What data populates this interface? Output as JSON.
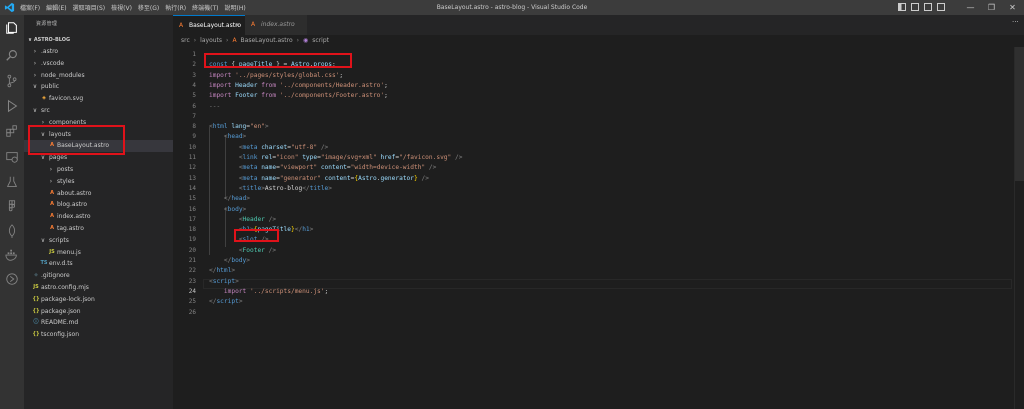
{
  "window": {
    "title": "BaseLayout.astro - astro-blog - Visual Studio Code",
    "menu": [
      "檔案(F)",
      "編輯(E)",
      "選取項目(S)",
      "檢視(V)",
      "移至(G)",
      "執行(R)",
      "終端機(T)",
      "說明(H)"
    ]
  },
  "explorer": {
    "title": "資源管理",
    "root": "ASTRO-BLOG",
    "items": [
      {
        "label": ".astro",
        "type": "folder",
        "open": false,
        "depth": 0
      },
      {
        "label": ".vscode",
        "type": "folder",
        "open": false,
        "depth": 0
      },
      {
        "label": "node_modules",
        "type": "folder",
        "open": false,
        "depth": 0
      },
      {
        "label": "public",
        "type": "folder",
        "open": true,
        "depth": 0
      },
      {
        "label": "favicon.svg",
        "type": "svg",
        "depth": 1
      },
      {
        "label": "src",
        "type": "folder",
        "open": true,
        "depth": 0
      },
      {
        "label": "components",
        "type": "folder",
        "open": false,
        "depth": 1
      },
      {
        "label": "layouts",
        "type": "folder",
        "open": true,
        "depth": 1
      },
      {
        "label": "BaseLayout.astro",
        "type": "astro",
        "depth": 2,
        "selected": true
      },
      {
        "label": "pages",
        "type": "folder",
        "open": true,
        "depth": 1
      },
      {
        "label": "posts",
        "type": "folder",
        "open": false,
        "depth": 2
      },
      {
        "label": "styles",
        "type": "folder",
        "open": false,
        "depth": 2
      },
      {
        "label": "about.astro",
        "type": "astro",
        "depth": 2
      },
      {
        "label": "blog.astro",
        "type": "astro",
        "depth": 2
      },
      {
        "label": "index.astro",
        "type": "astro",
        "depth": 2
      },
      {
        "label": "tag.astro",
        "type": "astro",
        "depth": 2
      },
      {
        "label": "scripts",
        "type": "folder",
        "open": true,
        "depth": 1
      },
      {
        "label": "menu.js",
        "type": "js",
        "depth": 2
      },
      {
        "label": "env.d.ts",
        "type": "ts",
        "depth": 1
      },
      {
        "label": ".gitignore",
        "type": "git",
        "depth": 0
      },
      {
        "label": "astro.config.mjs",
        "type": "js",
        "depth": 0
      },
      {
        "label": "package-lock.json",
        "type": "json",
        "depth": 0
      },
      {
        "label": "package.json",
        "type": "json",
        "depth": 0
      },
      {
        "label": "README.md",
        "type": "md",
        "depth": 0
      },
      {
        "label": "tsconfig.json",
        "type": "json",
        "depth": 0
      }
    ]
  },
  "tabs": [
    {
      "label": "BaseLayout.astro",
      "active": true
    },
    {
      "label": "index.astro",
      "active": false
    }
  ],
  "breadcrumb": [
    "src",
    "layouts",
    "BaseLayout.astro",
    "script"
  ],
  "editor": {
    "current_line": 24,
    "lines": [
      [
        [
          "g",
          "---"
        ]
      ],
      [
        [
          "k",
          "const"
        ],
        [
          "w",
          " { "
        ],
        [
          "v",
          "pageTitle"
        ],
        [
          "w",
          " } = "
        ],
        [
          "v",
          "Astro"
        ],
        [
          "w",
          "."
        ],
        [
          "v",
          "props"
        ],
        [
          "w",
          ";"
        ]
      ],
      [
        [
          "p",
          "import"
        ],
        [
          "w",
          " "
        ],
        [
          "s",
          "'../pages/styles/global.css'"
        ],
        [
          "w",
          ";"
        ]
      ],
      [
        [
          "p",
          "import"
        ],
        [
          "w",
          " "
        ],
        [
          "v",
          "Header"
        ],
        [
          "w",
          " "
        ],
        [
          "p",
          "from"
        ],
        [
          "w",
          " "
        ],
        [
          "s",
          "'../components/Header.astro'"
        ],
        [
          "w",
          ";"
        ]
      ],
      [
        [
          "p",
          "import"
        ],
        [
          "w",
          " "
        ],
        [
          "v",
          "Footer"
        ],
        [
          "w",
          " "
        ],
        [
          "p",
          "from"
        ],
        [
          "w",
          " "
        ],
        [
          "s",
          "'../components/Footer.astro'"
        ],
        [
          "w",
          ";"
        ]
      ],
      [
        [
          "g",
          "---"
        ]
      ],
      [],
      [
        [
          "g",
          "<"
        ],
        [
          "t",
          "html"
        ],
        [
          "w",
          " "
        ],
        [
          "a",
          "lang"
        ],
        [
          "w",
          "="
        ],
        [
          "s",
          "\"en\""
        ],
        [
          "g",
          ">"
        ]
      ],
      [
        [
          "w",
          "    "
        ],
        [
          "g",
          "<"
        ],
        [
          "t",
          "head"
        ],
        [
          "g",
          ">"
        ]
      ],
      [
        [
          "w",
          "        "
        ],
        [
          "g",
          "<"
        ],
        [
          "t",
          "meta"
        ],
        [
          "w",
          " "
        ],
        [
          "a",
          "charset"
        ],
        [
          "w",
          "="
        ],
        [
          "s",
          "\"utf-8\""
        ],
        [
          "w",
          " "
        ],
        [
          "g",
          "/>"
        ]
      ],
      [
        [
          "w",
          "        "
        ],
        [
          "g",
          "<"
        ],
        [
          "t",
          "link"
        ],
        [
          "w",
          " "
        ],
        [
          "a",
          "rel"
        ],
        [
          "w",
          "="
        ],
        [
          "s",
          "\"icon\""
        ],
        [
          "w",
          " "
        ],
        [
          "a",
          "type"
        ],
        [
          "w",
          "="
        ],
        [
          "s",
          "\"image/svg+xml\""
        ],
        [
          "w",
          " "
        ],
        [
          "a",
          "href"
        ],
        [
          "w",
          "="
        ],
        [
          "s",
          "\"/favicon.svg\""
        ],
        [
          "w",
          " "
        ],
        [
          "g",
          "/>"
        ]
      ],
      [
        [
          "w",
          "        "
        ],
        [
          "g",
          "<"
        ],
        [
          "t",
          "meta"
        ],
        [
          "w",
          " "
        ],
        [
          "a",
          "name"
        ],
        [
          "w",
          "="
        ],
        [
          "s",
          "\"viewport\""
        ],
        [
          "w",
          " "
        ],
        [
          "a",
          "content"
        ],
        [
          "w",
          "="
        ],
        [
          "s",
          "\"width=device-width\""
        ],
        [
          "w",
          " "
        ],
        [
          "g",
          "/>"
        ]
      ],
      [
        [
          "w",
          "        "
        ],
        [
          "g",
          "<"
        ],
        [
          "t",
          "meta"
        ],
        [
          "w",
          " "
        ],
        [
          "a",
          "name"
        ],
        [
          "w",
          "="
        ],
        [
          "s",
          "\"generator\""
        ],
        [
          "w",
          " "
        ],
        [
          "a",
          "content"
        ],
        [
          "w",
          "="
        ],
        [
          "y",
          "{"
        ],
        [
          "v",
          "Astro"
        ],
        [
          "w",
          "."
        ],
        [
          "v",
          "generator"
        ],
        [
          "y",
          "}"
        ],
        [
          "w",
          " "
        ],
        [
          "g",
          "/>"
        ]
      ],
      [
        [
          "w",
          "        "
        ],
        [
          "g",
          "<"
        ],
        [
          "t",
          "title"
        ],
        [
          "g",
          ">"
        ],
        [
          "w",
          "Astro-blog"
        ],
        [
          "g",
          "</"
        ],
        [
          "t",
          "title"
        ],
        [
          "g",
          ">"
        ]
      ],
      [
        [
          "w",
          "    "
        ],
        [
          "g",
          "</"
        ],
        [
          "t",
          "head"
        ],
        [
          "g",
          ">"
        ]
      ],
      [
        [
          "w",
          "    "
        ],
        [
          "g",
          "<"
        ],
        [
          "t",
          "body"
        ],
        [
          "g",
          ">"
        ]
      ],
      [
        [
          "w",
          "        "
        ],
        [
          "g",
          "<"
        ],
        [
          "c",
          "Header"
        ],
        [
          "w",
          " "
        ],
        [
          "g",
          "/>"
        ]
      ],
      [
        [
          "w",
          "        "
        ],
        [
          "g",
          "<"
        ],
        [
          "t",
          "h1"
        ],
        [
          "g",
          ">"
        ],
        [
          "y",
          "{"
        ],
        [
          "v",
          "pageTitle"
        ],
        [
          "y",
          "}"
        ],
        [
          "g",
          "</"
        ],
        [
          "t",
          "h1"
        ],
        [
          "g",
          ">"
        ]
      ],
      [
        [
          "w",
          "        "
        ],
        [
          "g",
          "<"
        ],
        [
          "t",
          "slot"
        ],
        [
          "w",
          " "
        ],
        [
          "g",
          "/>"
        ]
      ],
      [
        [
          "w",
          "        "
        ],
        [
          "g",
          "<"
        ],
        [
          "c",
          "Footer"
        ],
        [
          "w",
          " "
        ],
        [
          "g",
          "/>"
        ]
      ],
      [
        [
          "w",
          "    "
        ],
        [
          "g",
          "</"
        ],
        [
          "t",
          "body"
        ],
        [
          "g",
          ">"
        ]
      ],
      [
        [
          "g",
          "</"
        ],
        [
          "t",
          "html"
        ],
        [
          "g",
          ">"
        ]
      ],
      [
        [
          "g",
          "<"
        ],
        [
          "t",
          "script"
        ],
        [
          "g",
          ">"
        ]
      ],
      [
        [
          "w",
          "    "
        ],
        [
          "p",
          "import"
        ],
        [
          "w",
          " "
        ],
        [
          "s",
          "'../scripts/menu.js'"
        ],
        [
          "w",
          ";"
        ]
      ],
      [
        [
          "g",
          "</"
        ],
        [
          "t",
          "script"
        ],
        [
          "g",
          ">"
        ]
      ],
      []
    ]
  },
  "colors": {
    "highlight": "#e0121a",
    "accent": "#007acc",
    "astro_icon": "#ff7e33"
  }
}
